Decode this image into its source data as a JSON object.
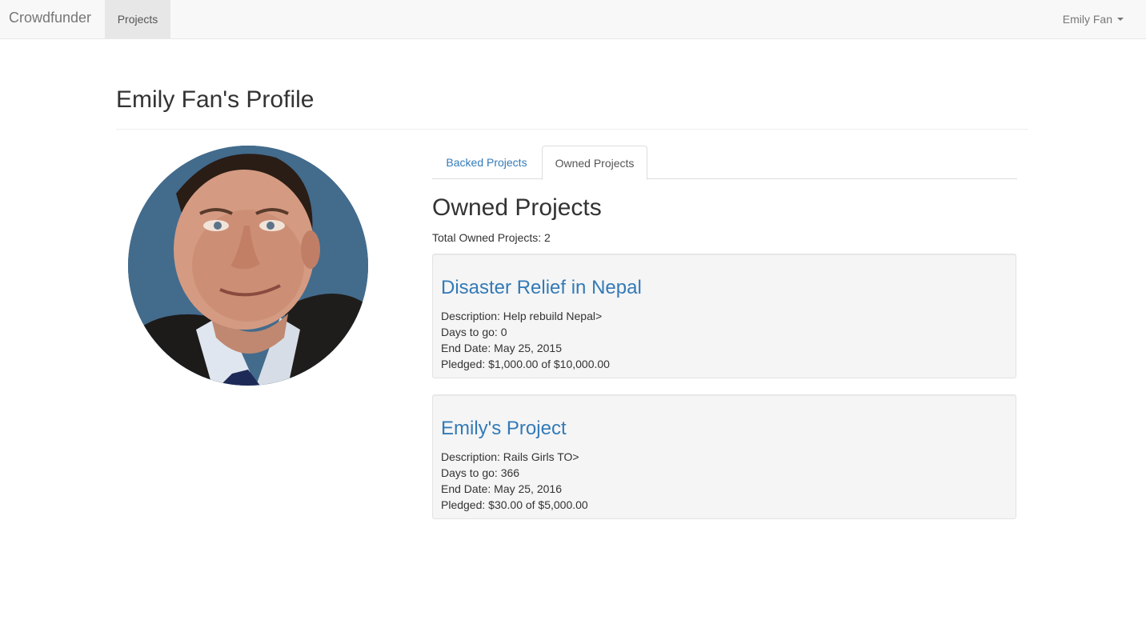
{
  "navbar": {
    "brand": "Crowdfunder",
    "projects_label": "Projects",
    "user_label": "Emily Fan"
  },
  "page": {
    "title": "Emily Fan's Profile"
  },
  "tabs": [
    {
      "label": "Backed Projects",
      "active": false
    },
    {
      "label": "Owned Projects",
      "active": true
    }
  ],
  "owned": {
    "heading": "Owned Projects",
    "total_label": "Total Owned Projects: 2",
    "projects": [
      {
        "title": "Disaster Relief in Nepal",
        "description": "Description: Help rebuild Nepal>",
        "days": "Days to go: 0",
        "end_date": "End Date: May 25, 2015",
        "pledged": "Pledged: $1,000.00 of $10,000.00"
      },
      {
        "title": "Emily's Project",
        "description": "Description: Rails Girls TO>",
        "days": "Days to go: 366",
        "end_date": "End Date: May 25, 2016",
        "pledged": "Pledged: $30.00 of $5,000.00"
      }
    ]
  },
  "colors": {
    "link": "#337ab7",
    "navbar_bg": "#f8f8f8",
    "card_bg": "#f5f5f5"
  },
  "icons": {
    "caret": "chevron-down-icon",
    "avatar": "profile-photo"
  }
}
